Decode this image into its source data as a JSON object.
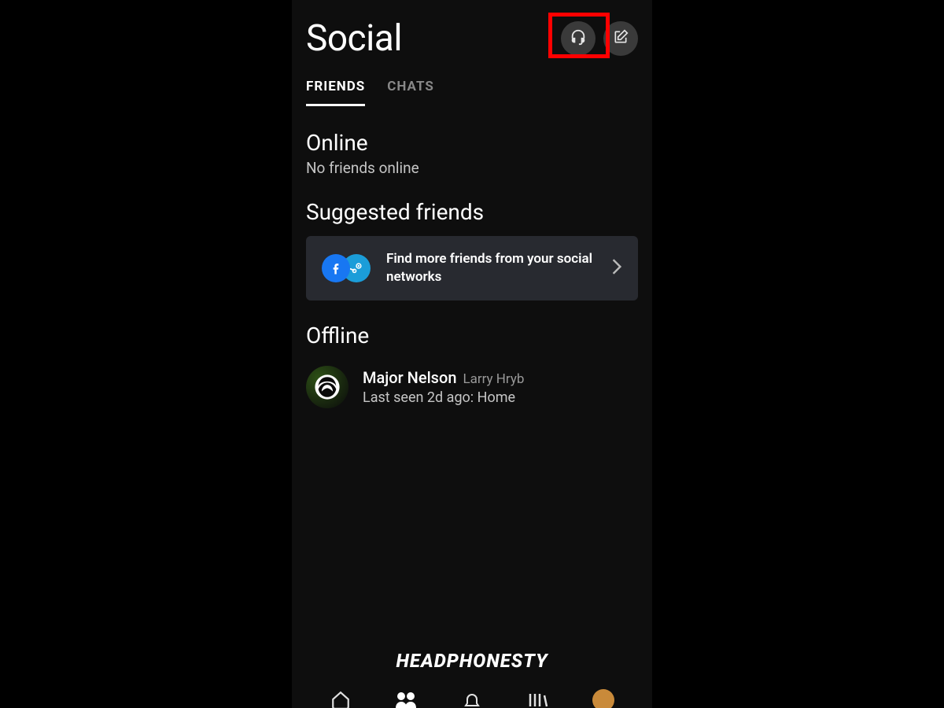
{
  "header": {
    "title": "Social"
  },
  "tabs": [
    {
      "label": "FRIENDS",
      "active": true
    },
    {
      "label": "CHATS",
      "active": false
    }
  ],
  "sections": {
    "online": {
      "title": "Online",
      "subtitle": "No friends online"
    },
    "suggested": {
      "title": "Suggested friends",
      "card_text": "Find more friends from your social networks"
    },
    "offline": {
      "title": "Offline",
      "friends": [
        {
          "gamertag": "Major Nelson",
          "realname": "Larry Hryb",
          "status": "Last seen 2d ago: Home"
        }
      ]
    }
  },
  "watermark": "HEADPHONESTY",
  "icons": {
    "headset": "headset-icon",
    "compose": "compose-icon",
    "facebook": "facebook-icon",
    "steam": "steam-icon",
    "chevron_right": "chevron-right-icon"
  },
  "colors": {
    "highlight": "#ff0000",
    "background": "#0e0e0e",
    "card": "#282a30",
    "facebook": "#1877f2",
    "steam": "#1b9dd9"
  }
}
